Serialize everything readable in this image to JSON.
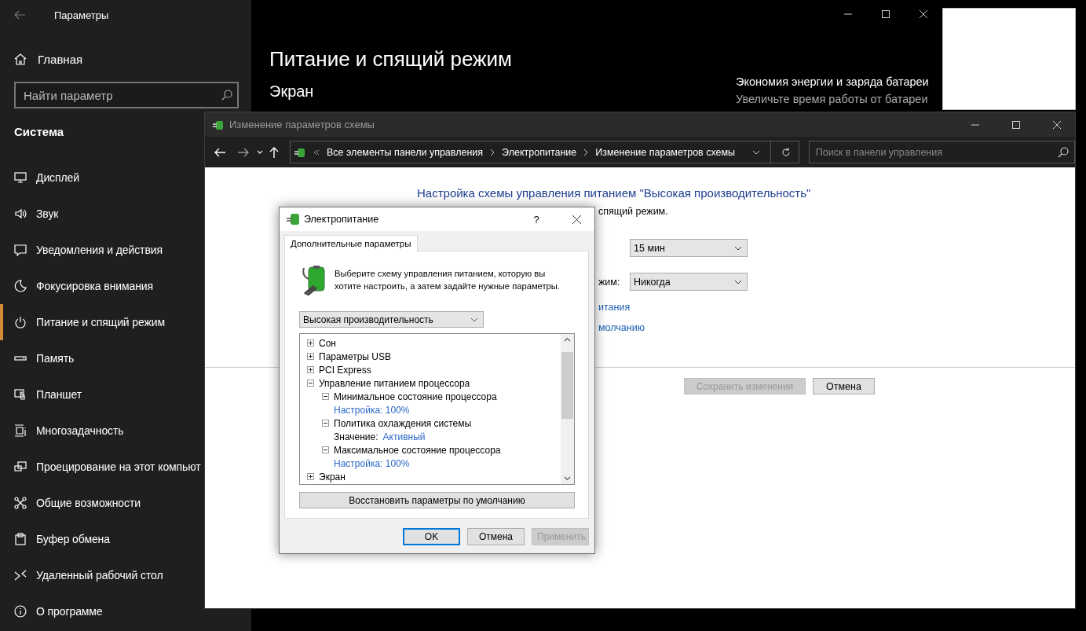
{
  "settings_window": {
    "title": "Параметры",
    "home": "Главная",
    "search": {
      "placeholder": "Найти параметр"
    },
    "section": "Система",
    "nav": [
      {
        "label": "Дисплей",
        "selected": false
      },
      {
        "label": "Звук",
        "selected": false
      },
      {
        "label": "Уведомления и действия",
        "selected": false
      },
      {
        "label": "Фокусировка внимания",
        "selected": false
      },
      {
        "label": "Питание и спящий режим",
        "selected": true
      },
      {
        "label": "Память",
        "selected": false
      },
      {
        "label": "Планшет",
        "selected": false
      },
      {
        "label": "Многозадачность",
        "selected": false
      },
      {
        "label": "Проецирование на этот компьют",
        "selected": false
      },
      {
        "label": "Общие возможности",
        "selected": false
      },
      {
        "label": "Буфер обмена",
        "selected": false
      },
      {
        "label": "Удаленный рабочий стол",
        "selected": false
      },
      {
        "label": "О программе",
        "selected": false
      }
    ],
    "page_title": "Питание и спящий режим",
    "heading": "Экран",
    "side_title": "Экономия энергии и заряда батареи",
    "side_text": "Увеличьте время работы от батареи"
  },
  "control_panel": {
    "title": "Изменение параметров схемы",
    "breadcrumb": [
      "Все элементы панели управления",
      "Электропитание",
      "Изменение параметров схемы"
    ],
    "search": {
      "placeholder": "Поиск в панели управления"
    },
    "heading": "Настройка схемы управления питанием \"Высокая производительность\"",
    "subtitle": "спящий режим.",
    "settings": [
      {
        "value": "15 мин"
      },
      {
        "label": "жим:",
        "value": "Никогда"
      }
    ],
    "links": [
      "итания",
      "молчанию"
    ],
    "buttons": [
      {
        "label": "Сохранить изменения",
        "disabled": true
      },
      {
        "label": "Отмена",
        "disabled": false
      }
    ]
  },
  "dialog": {
    "title": "Электропитание",
    "help": "?",
    "tab": "Дополнительные параметры",
    "intro": "Выберите схему управления питанием, которую вы хотите настроить, а затем задайте нужные параметры.",
    "plan": "Высокая производительность",
    "tree": [
      {
        "label": "Сон",
        "expanded": false
      },
      {
        "label": "Параметры USB",
        "expanded": false
      },
      {
        "label": "PCI Express",
        "expanded": false
      },
      {
        "label": "Управление питанием процессора",
        "expanded": true,
        "children": [
          {
            "label": "Минимальное состояние процессора",
            "expanded": true,
            "children": [
              {
                "kind": "setting",
                "label": "Настройка: 100%"
              }
            ]
          },
          {
            "label": "Политика охлаждения системы",
            "expanded": true,
            "children": [
              {
                "kind": "value",
                "label": "Значение:",
                "value": "Активный"
              }
            ]
          },
          {
            "label": "Максимальное состояние процессора",
            "expanded": true,
            "children": [
              {
                "kind": "setting",
                "label": "Настройка: 100%"
              }
            ]
          }
        ]
      },
      {
        "label": "Экран",
        "expanded": false
      }
    ],
    "restore": "Восстановить параметры по умолчанию",
    "buttons": [
      {
        "label": "OK",
        "default": true,
        "disabled": false
      },
      {
        "label": "Отмена",
        "default": false,
        "disabled": false
      },
      {
        "label": "Применить",
        "default": false,
        "disabled": true
      }
    ]
  }
}
